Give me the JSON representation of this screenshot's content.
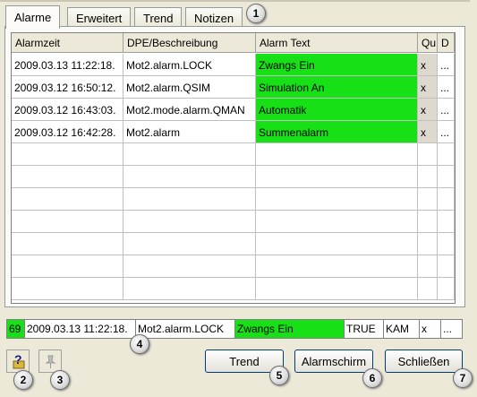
{
  "tabs": [
    {
      "label": "Alarme"
    },
    {
      "label": "Erweitert"
    },
    {
      "label": "Trend"
    },
    {
      "label": "Notizen"
    }
  ],
  "table": {
    "columns": [
      "Alarmzeit",
      "DPE/Beschreibung",
      "Alarm Text",
      "Qu",
      "D"
    ],
    "rows": [
      {
        "time": "2009.03.13 11:22:18.",
        "dpe": "Mot2.alarm.LOCK",
        "text": "Zwangs Ein",
        "qu": "x",
        "d": "..."
      },
      {
        "time": "2009.03.12 16:50:12.",
        "dpe": "Mot2.alarm.QSIM",
        "text": "Simulation An",
        "qu": "x",
        "d": "..."
      },
      {
        "time": "2009.03.12 16:43:03.",
        "dpe": "Mot2.mode.alarm.QMAN",
        "text": "Automatik",
        "qu": "x",
        "d": "..."
      },
      {
        "time": "2009.03.12 16:42:28.",
        "dpe": "Mot2.alarm",
        "text": "Summenalarm",
        "qu": "x",
        "d": "..."
      }
    ]
  },
  "status_line": {
    "priority": "69",
    "time": "2009.03.13 11:22:18.",
    "dpe": "Mot2.alarm.LOCK",
    "text": "Zwangs Ein",
    "value": "TRUE",
    "state": "KAM",
    "qu": "x",
    "d": "..."
  },
  "buttons": {
    "trend": "Trend",
    "alarmschirm": "Alarmschirm",
    "schliessen": "Schließen"
  },
  "icons": {
    "help": "help-question-icon",
    "pin": "pin-icon"
  },
  "callouts": [
    "1",
    "2",
    "3",
    "4",
    "5",
    "6",
    "7"
  ],
  "colors": {
    "alarm_active": "#17e017",
    "dialog_bg": "#ece9d8",
    "button_border": "#003c74"
  }
}
